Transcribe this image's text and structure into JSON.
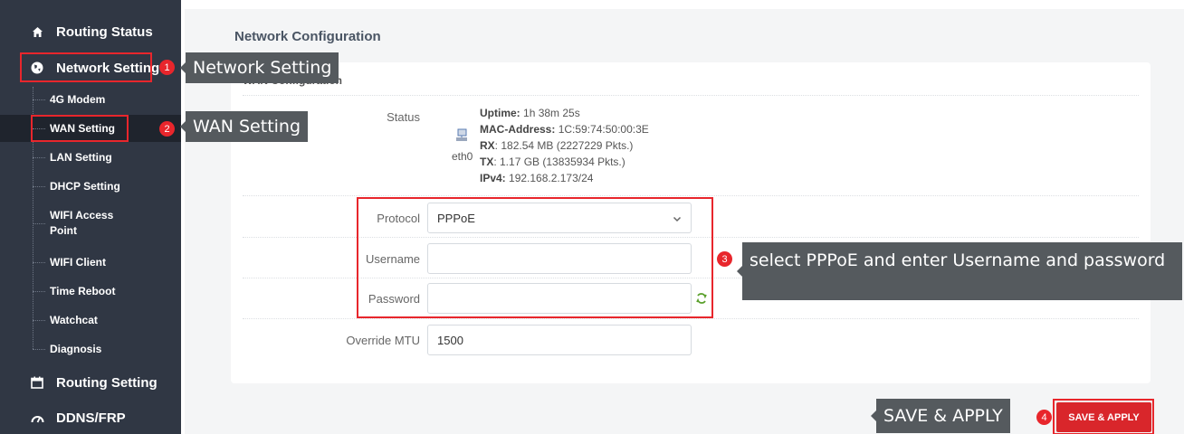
{
  "sidebar": {
    "main_items": [
      {
        "label": "Routing Status",
        "icon": "home-icon"
      },
      {
        "label": "Network Setting",
        "icon": "globe-icon"
      },
      {
        "label": "Routing Setting",
        "icon": "calendar-icon"
      },
      {
        "label": "DDNS/FRP",
        "icon": "speedometer-icon"
      }
    ],
    "sub_items": [
      {
        "label": "4G Modem"
      },
      {
        "label": "WAN Setting"
      },
      {
        "label": "LAN Setting"
      },
      {
        "label": "DHCP Setting"
      },
      {
        "label": "WIFI Access Point"
      },
      {
        "label": "WIFI Client"
      },
      {
        "label": "Time Reboot"
      },
      {
        "label": "Watchcat"
      },
      {
        "label": "Diagnosis"
      }
    ]
  },
  "page": {
    "title": "Network Configuration",
    "section_title": "WAN Configuration"
  },
  "status": {
    "label": "Status",
    "interface": "eth0",
    "uptime_key": "Uptime:",
    "uptime": "1h 38m 25s",
    "mac_key": "MAC-Address:",
    "mac": "1C:59:74:50:00:3E",
    "rx_key": "RX",
    "rx": ": 182.54 MB (2227229 Pkts.)",
    "tx_key": "TX",
    "tx": ": 1.17 GB (13835934 Pkts.)",
    "ipv4_key": "IPv4:",
    "ipv4": "192.168.2.173/24"
  },
  "form": {
    "protocol_label": "Protocol",
    "protocol_value": "PPPoE",
    "username_label": "Username",
    "username_value": "",
    "password_label": "Password",
    "password_value": "",
    "mtu_label": "Override MTU",
    "mtu_value": "1500"
  },
  "save_button": "SAVE & APPLY",
  "annotations": [
    {
      "num": "1",
      "text": "Network Setting"
    },
    {
      "num": "2",
      "text": "WAN Setting"
    },
    {
      "num": "3",
      "text": "select PPPoE and enter Username and password"
    },
    {
      "num": "4",
      "text": "SAVE & APPLY"
    }
  ],
  "colors": {
    "sidebar": "#303744",
    "accent": "#e8262c",
    "callout": "#555a5e"
  }
}
